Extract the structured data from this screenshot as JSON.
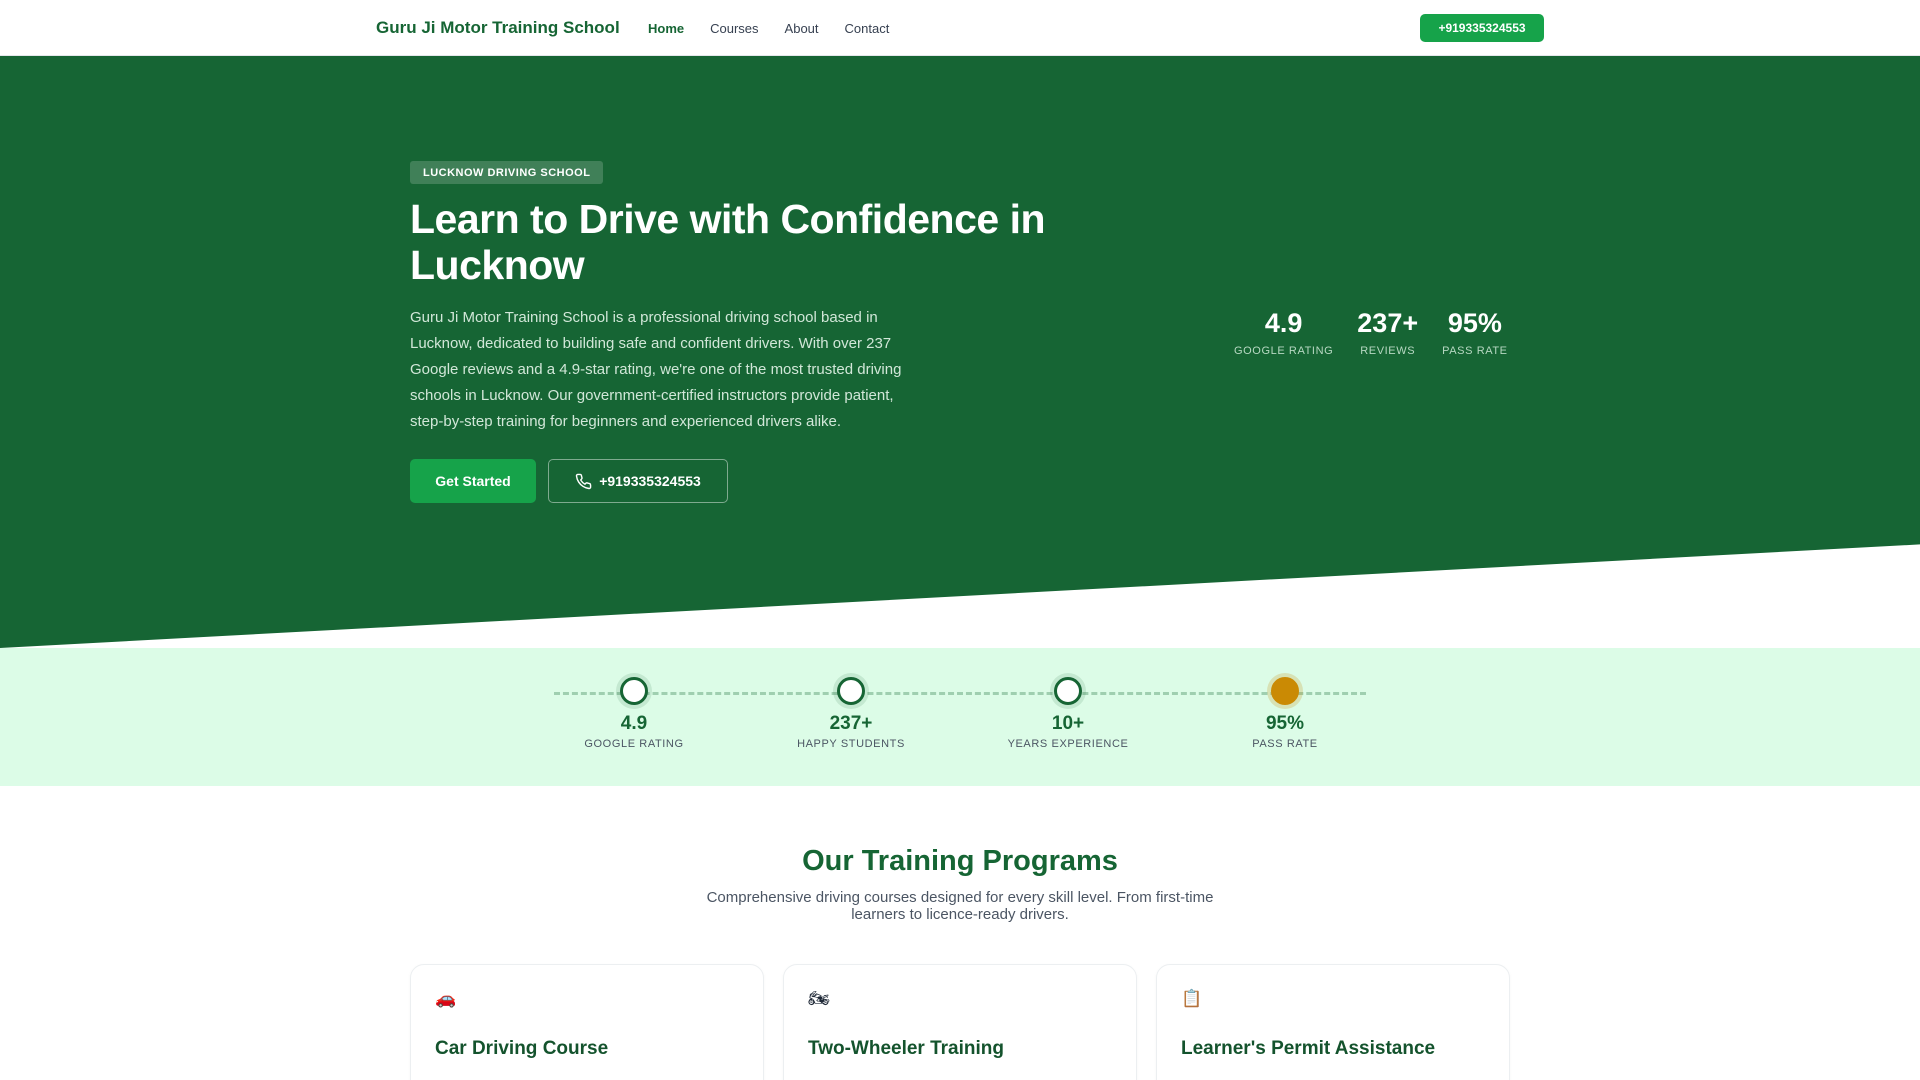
{
  "nav": {
    "brand": "Guru Ji Motor Training School",
    "links": [
      "Home",
      "Courses",
      "About",
      "Contact"
    ],
    "active": "Home",
    "cta": "+919335324553"
  },
  "hero": {
    "badge": "LUCKNOW DRIVING SCHOOL",
    "title": "Learn to Drive with Confidence in Lucknow",
    "description": "Guru Ji Motor Training School is a professional driving school based in Lucknow, dedicated to building safe and confident drivers. With over 237 Google reviews and a 4.9-star rating, we're one of the most trusted driving schools in Lucknow. Our government-certified instructors provide patient, step-by-step training for beginners and experienced drivers alike.",
    "primary_button": "Get Started",
    "phone_button": "+919335324553",
    "phone_icon": "phone-icon",
    "stats": [
      {
        "value": "4.9",
        "label": "GOOGLE RATING"
      },
      {
        "value": "237+",
        "label": "REVIEWS"
      },
      {
        "value": "95%",
        "label": "PASS RATE"
      }
    ]
  },
  "milestones": [
    {
      "value": "4.9",
      "label": "GOOGLE RATING",
      "style": "ring"
    },
    {
      "value": "237+",
      "label": "HAPPY STUDENTS",
      "style": "ring"
    },
    {
      "value": "10+",
      "label": "YEARS EXPERIENCE",
      "style": "ring"
    },
    {
      "value": "95%",
      "label": "PASS RATE",
      "style": "gold"
    }
  ],
  "programs": {
    "title": "Our Training Programs",
    "subtitle": "Comprehensive driving courses designed for every skill level. From first-time learners to licence-ready drivers.",
    "cards": [
      {
        "icon": "🚗",
        "icon_name": "car-icon",
        "title": "Car Driving Course"
      },
      {
        "icon": "🏍",
        "icon_name": "motorcycle-icon",
        "title": "Two-Wheeler Training"
      },
      {
        "icon": "📋",
        "icon_name": "clipboard-icon",
        "title": "Learner's Permit Assistance"
      }
    ]
  },
  "colors": {
    "brand_green": "#166534",
    "accent_green": "#16a34a",
    "strip_bg": "#dcfce7",
    "gold": "#ca8a04"
  }
}
